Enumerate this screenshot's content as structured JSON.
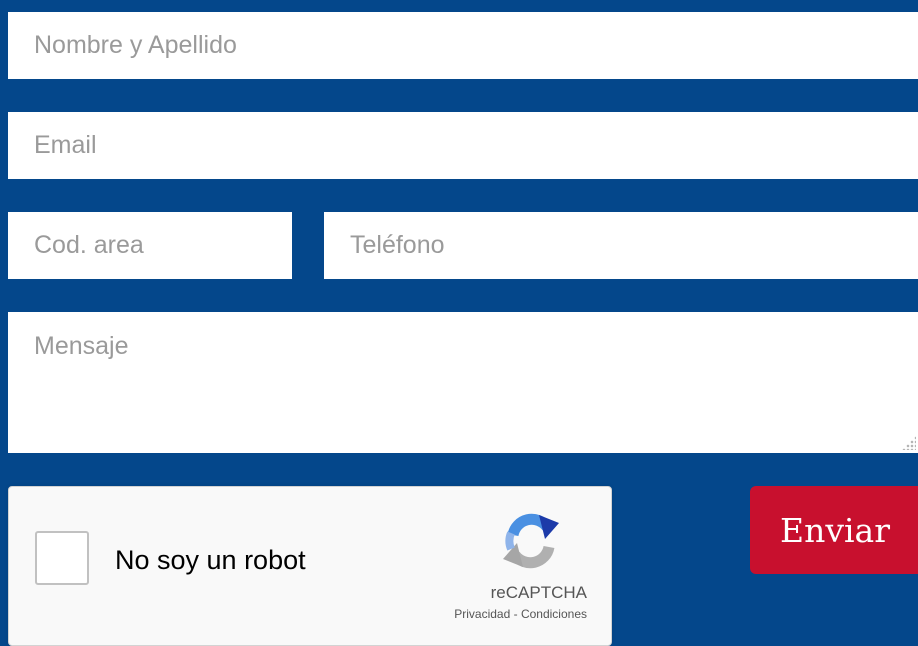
{
  "form": {
    "name": {
      "placeholder": "Nombre y Apellido",
      "value": ""
    },
    "email": {
      "placeholder": "Email",
      "value": ""
    },
    "area": {
      "placeholder": "Cod. area",
      "value": ""
    },
    "phone": {
      "placeholder": "Teléfono",
      "value": ""
    },
    "message": {
      "placeholder": "Mensaje",
      "value": ""
    },
    "submit_label": "Enviar"
  },
  "recaptcha": {
    "checkbox_label": "No soy un robot",
    "checked": false,
    "brand": "reCAPTCHA",
    "privacy": "Privacidad",
    "separator": " - ",
    "terms": "Condiciones",
    "logo_icon": "recaptcha-logo-icon"
  },
  "colors": {
    "background": "#04478b",
    "field": "#ffffff",
    "placeholder": "#9a9a9a",
    "submit": "#c8102e",
    "recaptcha_bg": "#f9f9f9"
  }
}
